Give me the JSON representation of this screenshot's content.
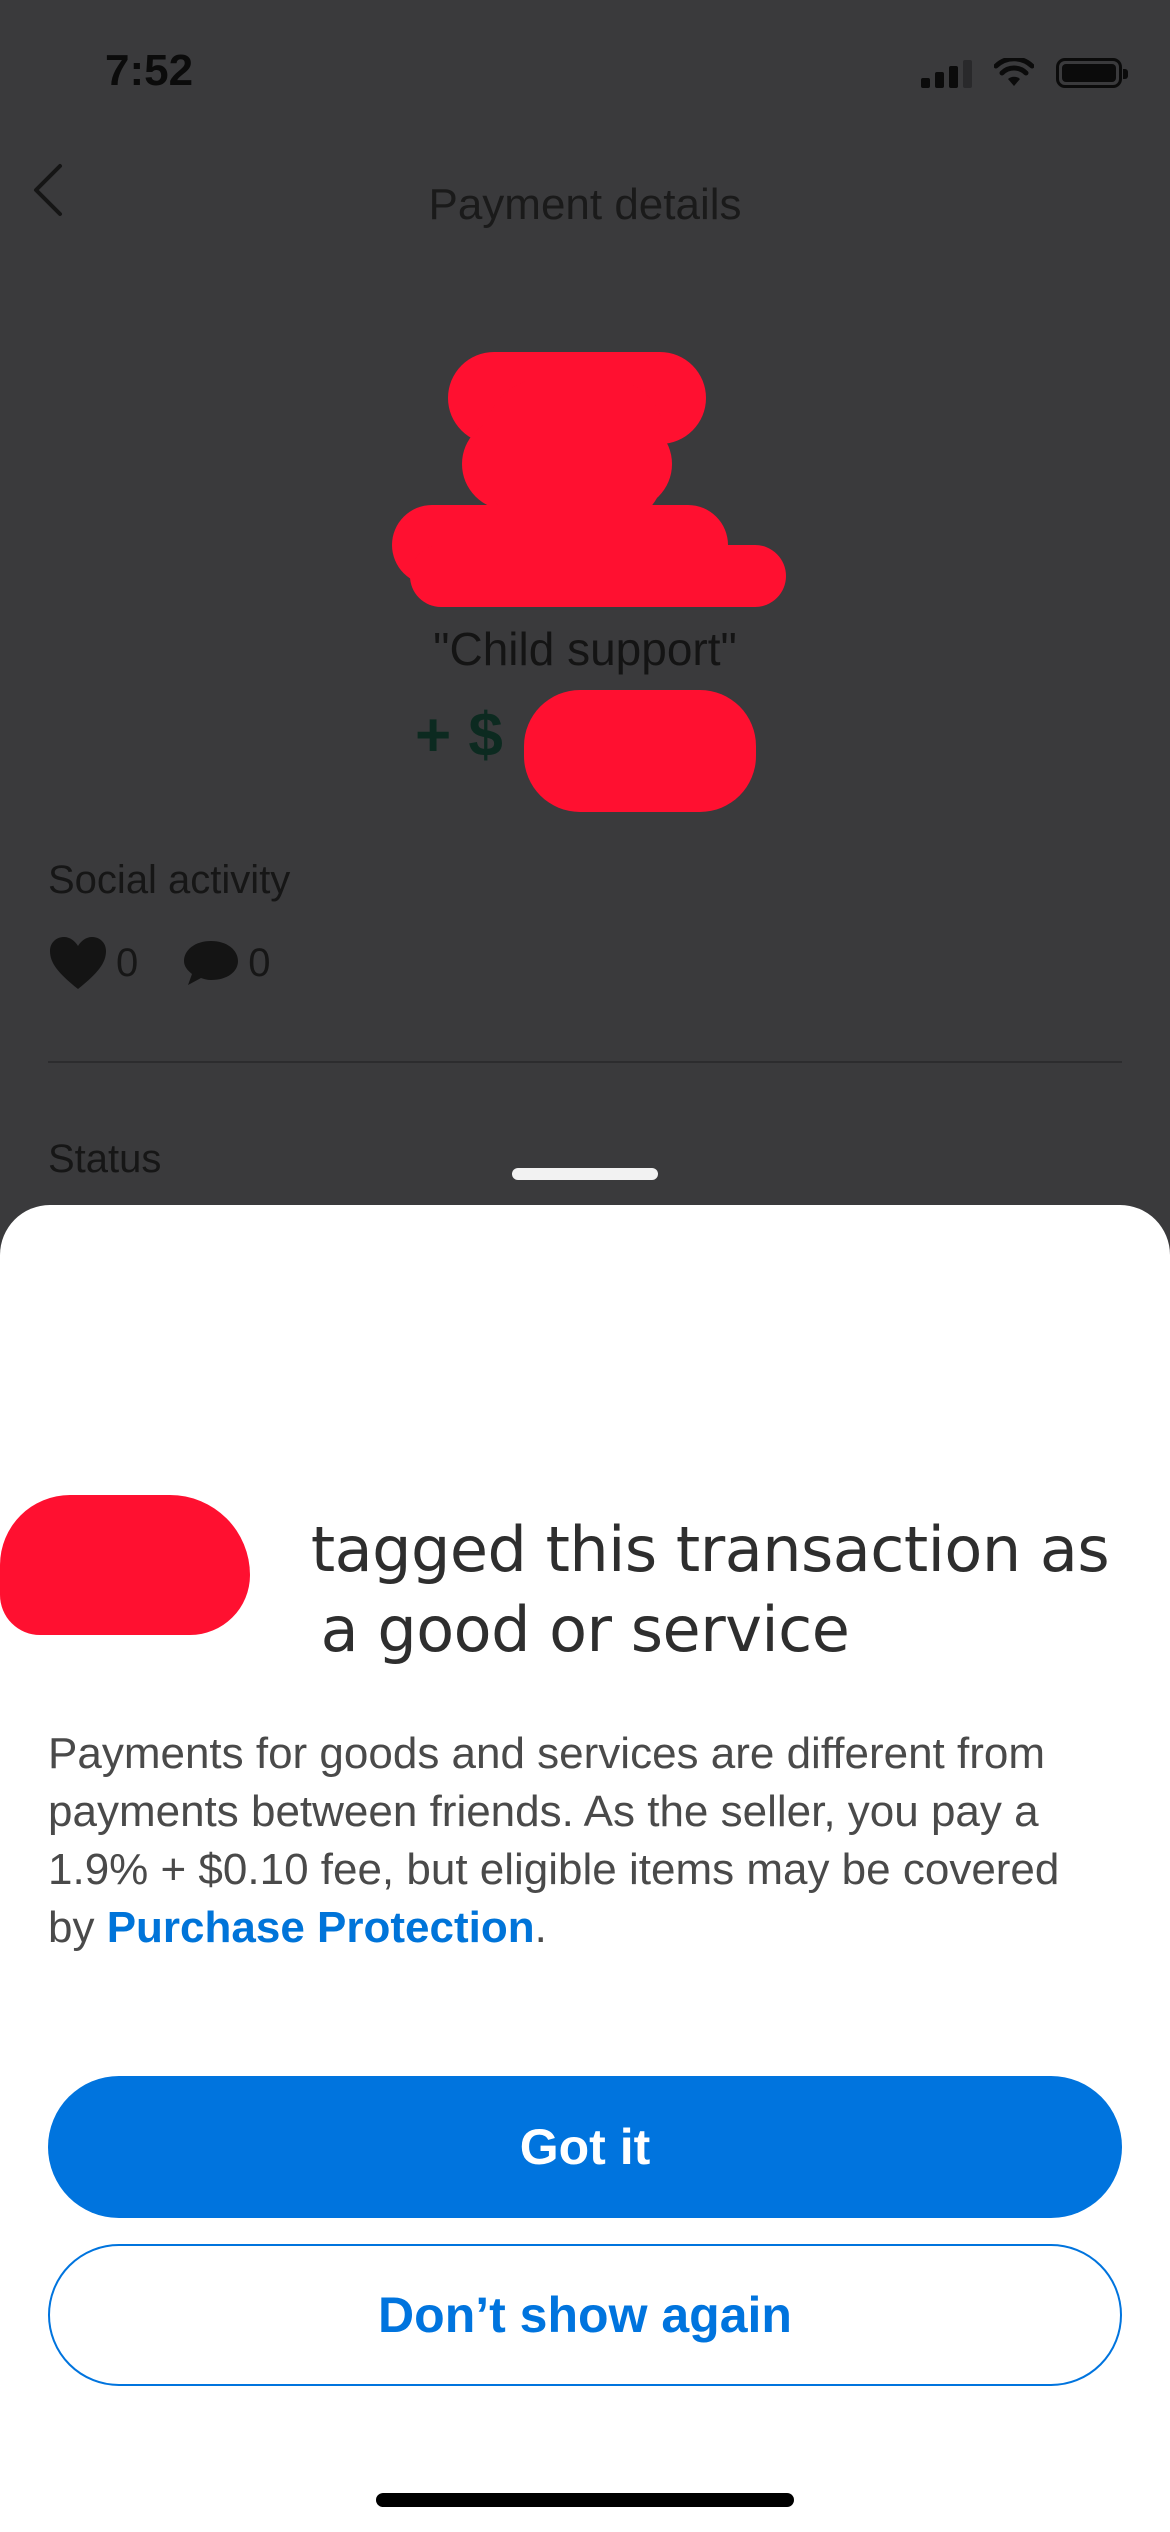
{
  "status_bar": {
    "time": "7:52"
  },
  "nav": {
    "title": "Payment details"
  },
  "transaction": {
    "memo": "\"Child support\"",
    "amount_prefix": "+ $"
  },
  "social": {
    "label": "Social activity",
    "likes": "0",
    "comments": "0"
  },
  "status": {
    "label": "Status"
  },
  "sheet": {
    "title_line1": "tagged this transaction as",
    "title_line2": "a good or service",
    "body_text": "Payments for goods and services are different from payments between friends. As the seller, you pay a 1.9% + $0.10 fee, but eligible items may be covered by ",
    "link_text": "Purchase Protection",
    "body_end": ".",
    "primary_button": "Got it",
    "secondary_button": "Don’t show again"
  },
  "colors": {
    "accent": "#0074DE",
    "overlay": "#3A3A3C",
    "redaction": "#FF1030"
  },
  "icons": [
    "back-chevron-icon",
    "signal-icon",
    "wifi-icon",
    "battery-icon",
    "heart-icon",
    "comment-icon"
  ]
}
